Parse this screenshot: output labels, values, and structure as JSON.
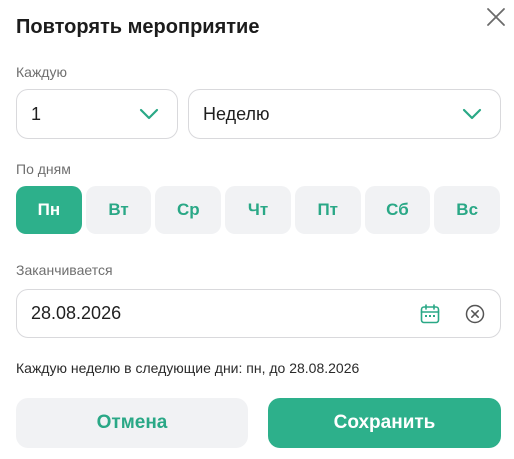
{
  "dialog": {
    "title": "Повторять мероприятие",
    "close_icon": "close-icon"
  },
  "interval": {
    "label": "Каждую",
    "count_value": "1",
    "unit_value": "Неделю"
  },
  "days": {
    "label": "По дням",
    "items": [
      {
        "label": "Пн",
        "selected": true
      },
      {
        "label": "Вт",
        "selected": false
      },
      {
        "label": "Ср",
        "selected": false
      },
      {
        "label": "Чт",
        "selected": false
      },
      {
        "label": "Пт",
        "selected": false
      },
      {
        "label": "Сб",
        "selected": false
      },
      {
        "label": "Вс",
        "selected": false
      }
    ]
  },
  "end": {
    "label": "Заканчивается",
    "date_value": "28.08.2026",
    "calendar_icon": "calendar-icon",
    "clear_icon": "clear-icon"
  },
  "summary": "Каждую неделю в следующие дни: пн, до 28.08.2026",
  "actions": {
    "cancel_label": "Отмена",
    "save_label": "Сохранить"
  },
  "colors": {
    "accent": "#2db08b",
    "accent_text": "#2aa886",
    "muted_bg": "#f1f2f4",
    "border": "#d9d9dc"
  }
}
